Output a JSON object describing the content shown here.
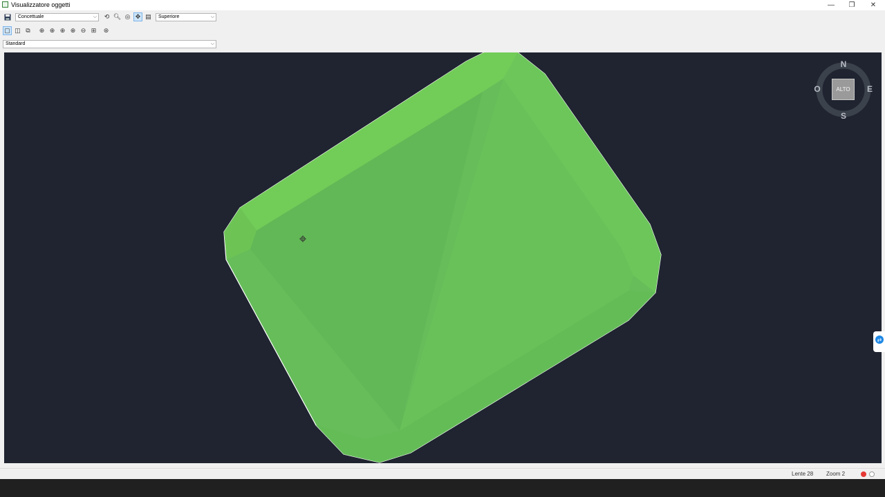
{
  "window": {
    "title": "Visualizzatore oggetti"
  },
  "toolbar": {
    "visual_style": "Concettuale",
    "view": "Superiore",
    "view_preset": "Standard"
  },
  "viewcube": {
    "north": "N",
    "south": "S",
    "east": "E",
    "west": "O",
    "face": "ALTO"
  },
  "status": {
    "lens": "Lente 28",
    "zoom": "Zoom 2"
  },
  "colors": {
    "viewport_bg": "#1f2430",
    "object_fill": "#66bd5a"
  }
}
